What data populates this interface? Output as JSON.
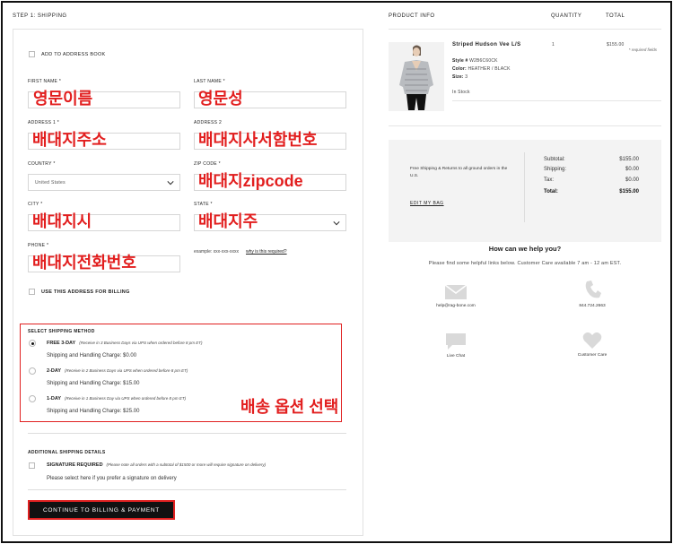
{
  "step": {
    "title": "STEP 1: SHIPPING"
  },
  "form": {
    "required_note": "* required fields",
    "add_to_address_book": "ADD TO ADDRESS BOOK",
    "first_name": {
      "label": "FIRST NAME *",
      "value": "영문이름"
    },
    "last_name": {
      "label": "LAST NAME *",
      "value": "영문성"
    },
    "address1": {
      "label": "ADDRESS 1 *",
      "value": "배대지주소"
    },
    "address2": {
      "label": "ADDRESS 2",
      "value": "배대지사서함번호"
    },
    "country": {
      "label": "COUNTRY *",
      "value": "United States"
    },
    "zip": {
      "label": "ZIP CODE *",
      "value": "배대지zipcode"
    },
    "city": {
      "label": "CITY *",
      "value": "배대지시"
    },
    "state": {
      "label": "STATE *",
      "value": "배대지주"
    },
    "phone": {
      "label": "PHONE *",
      "value": "배대지전화번호"
    },
    "phone_example": "example: xxx-xxx-xxxx",
    "phone_why": "why is this required?",
    "use_for_billing": "USE THIS ADDRESS FOR BILLING"
  },
  "shipping": {
    "heading": "SELECT SHIPPING METHOD",
    "annotation": "배송 옵션 선택",
    "options": [
      {
        "title": "FREE 3-DAY",
        "note": "(Receive in 3 Business Days via UPS when ordered before 8 pm ET)",
        "charge": "Shipping and Handling Charge: $0.00",
        "selected": true
      },
      {
        "title": "2-DAY",
        "note": "(Receive in 2 Business Days via UPS when ordered before 8 pm ET)",
        "charge": "Shipping and Handling Charge: $15.00",
        "selected": false
      },
      {
        "title": "1-DAY",
        "note": "(Receive in 1 Business Day via UPS when ordered before 8 pm ET)",
        "charge": "Shipping and Handling Charge: $25.00",
        "selected": false
      }
    ]
  },
  "additional": {
    "heading": "ADDITIONAL SHIPPING DETAILS",
    "signature_title": "SIGNATURE REQUIRED",
    "signature_note": "(Please note all orders with a subtotal of $1500 or more will require signature on delivery)",
    "signature_sub": "Please select here if you prefer a signature on delivery"
  },
  "cta": {
    "label": "CONTINUE TO BILLING & PAYMENT"
  },
  "order": {
    "headers": {
      "product": "PRODUCT INFO",
      "quantity": "QUANTITY",
      "total": "TOTAL"
    },
    "product": {
      "name": "Striped Hudson Vee L/S",
      "style_label": "Style #",
      "style": "W2B6C60CK",
      "color_label": "Color:",
      "color": "HEATHER / BLACK",
      "size_label": "Size:",
      "size": "3",
      "stock": "In Stock",
      "quantity": "1",
      "total": "$155.00"
    },
    "summary": {
      "note": "Free Shipping & Returns to all ground orders in the U.S.",
      "edit": "EDIT MY BAG",
      "rows": [
        {
          "label": "Subtotal:",
          "value": "$155.00"
        },
        {
          "label": "Shipping:",
          "value": "$0.00"
        },
        {
          "label": "Tax:",
          "value": "$0.00"
        },
        {
          "label": "Total:",
          "value": "$155.00"
        }
      ]
    }
  },
  "help": {
    "title": "How can we help you?",
    "subtitle": "Please find some helpful links below. Customer Care available 7 am - 12 am EST.",
    "items": [
      {
        "icon": "mail-icon",
        "label": "help@rag-bone.com"
      },
      {
        "icon": "phone-icon",
        "label": "844.724.2663"
      },
      {
        "icon": "chat-icon",
        "label": "Live Chat"
      },
      {
        "icon": "heart-icon",
        "label": "Customer Care"
      }
    ]
  }
}
